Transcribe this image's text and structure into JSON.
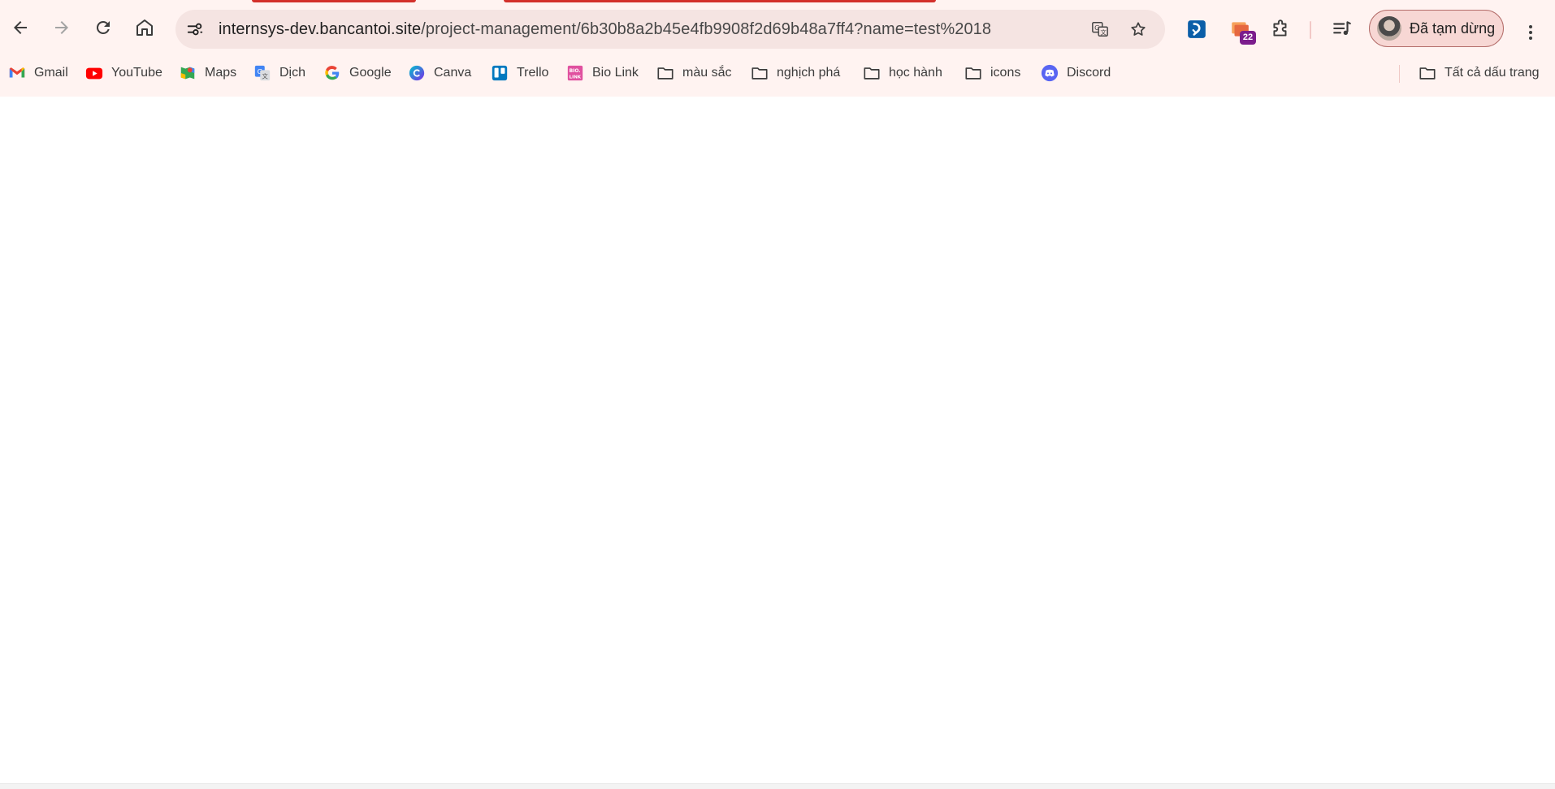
{
  "browser": {
    "url_host": "internsys-dev.bancantoi.site",
    "url_path": "/project-management/6b30b8a2b45e4fb9908f2d69b48a7ff4?name=test%2018",
    "extension_badge": "22",
    "profile_label": "Đã tạm dừng",
    "accent_color": "#d3302b",
    "chrome_background": "#fff3f1"
  },
  "toolbar": {
    "icons": [
      "back-icon",
      "forward-icon",
      "reload-icon",
      "home-icon",
      "site-settings-icon",
      "translate-icon",
      "bookmark-star-icon",
      "extension-icon",
      "extensions-puzzle-icon",
      "media-control-icon",
      "more-menu-icon"
    ]
  },
  "bookmarks": [
    {
      "label": "Gmail",
      "icon": "gmail-icon"
    },
    {
      "label": "YouTube",
      "icon": "youtube-icon"
    },
    {
      "label": "Maps",
      "icon": "maps-icon"
    },
    {
      "label": "Dịch",
      "icon": "translate-icon"
    },
    {
      "label": "Google",
      "icon": "google-icon"
    },
    {
      "label": "Canva",
      "icon": "canva-icon"
    },
    {
      "label": "Trello",
      "icon": "trello-icon"
    },
    {
      "label": "Bio Link",
      "icon": "biolink-icon"
    },
    {
      "label": "màu sắc",
      "icon": "folder-icon"
    },
    {
      "label": "nghịch phá",
      "icon": "folder-icon"
    },
    {
      "label": "học hành",
      "icon": "folder-icon"
    },
    {
      "label": "icons",
      "icon": "folder-icon"
    },
    {
      "label": "Discord",
      "icon": "discord-icon"
    }
  ],
  "all_bookmarks": {
    "label": "Tất cả dấu trang",
    "icon": "folder-icon"
  }
}
